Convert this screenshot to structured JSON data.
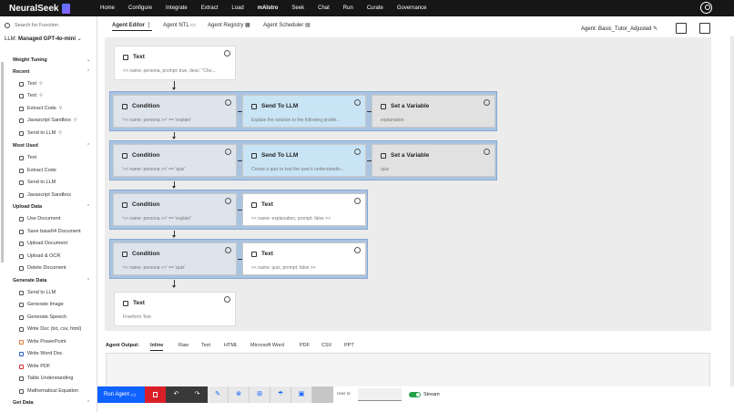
{
  "topnav": {
    "brand": "NeuralSeek",
    "items": [
      "Home",
      "Configure",
      "Integrate",
      "Extract",
      "Load",
      "mAIstro",
      "Seek",
      "Chat",
      "Run",
      "Curate",
      "Governance"
    ]
  },
  "sidebar": {
    "search_placeholder": "Search for Function",
    "llm_label": "LLM:",
    "llm_value": "Managed GPT-4o-mini",
    "sections": {
      "weight_tuning": "Weight Tuning",
      "recent": "Recent",
      "most_used": "Most Used",
      "upload_data": "Upload Data",
      "generate_data": "Generate Data",
      "get_data": "Get Data"
    },
    "recent_items": [
      "Text",
      "Text",
      "Extract Code",
      "Javascript Sandbox",
      "Send to LLM"
    ],
    "most_used_items": [
      "Text",
      "Extract Code",
      "Send to LLM",
      "Javascript Sandbox"
    ],
    "upload_items": [
      "Use Document",
      "Save base64 Document",
      "Upload Document",
      "Upload & OCR",
      "Delete Document"
    ],
    "generate_items": [
      "Send to LLM",
      "Generate Image",
      "Generate Speech",
      "Write Doc (txt, csv, html)",
      "Write PowerPoint",
      "Write Word Doc",
      "Write PDF",
      "Table Understanding",
      "Mathematical Equation"
    ]
  },
  "tabs": [
    "Agent Editor",
    "Agent NTL",
    "Agent Registry",
    "Agent Scheduler"
  ],
  "agent_label": "Agent: Basic_Tutor_Adjusted",
  "nodes": {
    "n1": {
      "title": "Text",
      "sub": "<< name: persona, prompt: true, desc: \"Cho..."
    },
    "r1c": {
      "title": "Condition",
      "sub": "'<< name: persona >>' == 'explain'"
    },
    "r1l": {
      "title": "Send To LLM",
      "sub": "Explain the solution to the following proble..."
    },
    "r1v": {
      "title": "Set a Variable",
      "sub": "explanation"
    },
    "r2c": {
      "title": "Condition",
      "sub": "'<< name: persona >>' == 'quiz'"
    },
    "r2l": {
      "title": "Send To LLM",
      "sub": "Create a quiz to test the user's understandin..."
    },
    "r2v": {
      "title": "Set a Variable",
      "sub": "quiz"
    },
    "r3c": {
      "title": "Condition",
      "sub": "'<< name: persona >>' == 'explain'"
    },
    "r3t": {
      "title": "Text",
      "sub": "<< name: explanation, prompt: false >>"
    },
    "r4c": {
      "title": "Condition",
      "sub": "'<< name: persona >>' == 'quiz'"
    },
    "r4t": {
      "title": "Text",
      "sub": "<< name: quiz, prompt: false >>"
    },
    "n6": {
      "title": "Text",
      "sub": "Freeform Text"
    }
  },
  "output": {
    "label": "Agent Output:",
    "tabs": [
      "Inline",
      "Raw",
      "Text",
      "HTML",
      "Microsoft Word",
      "PDF",
      "CSV",
      "PPT"
    ]
  },
  "bottombar": {
    "run_label": "Run Agent",
    "user_id_label": "User Id",
    "stream_label": "Stream",
    "stream_on": true
  }
}
